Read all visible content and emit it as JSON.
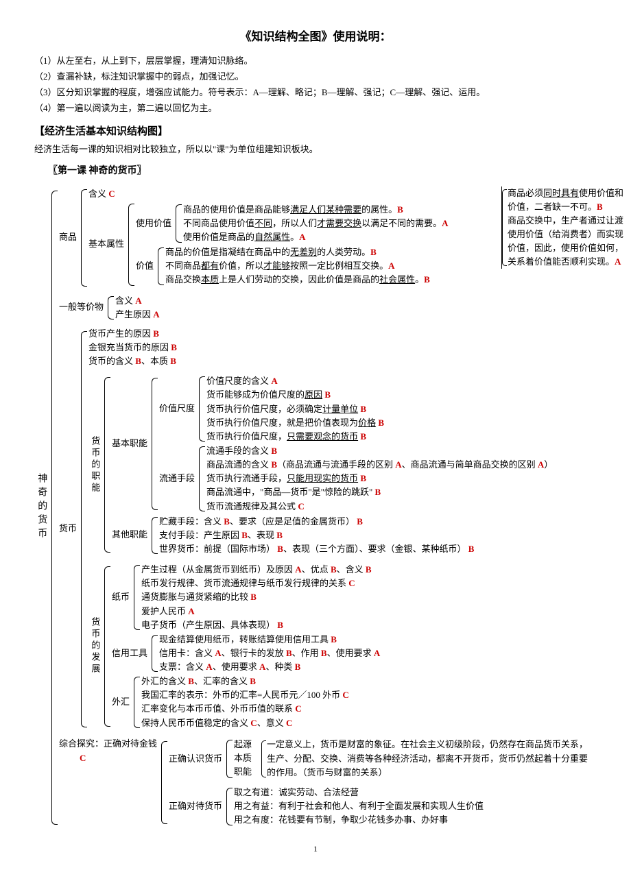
{
  "title": "《知识结构全图》使用说明：",
  "intro": [
    "（1）从左至右，从上到下，层层掌握，理清知识脉络。",
    "（2）查漏补缺，标注知识掌握中的弱点，加强记忆。",
    "（3）区分知识掌握的程度，增强应试能力。符号表示：A—理解、略记；B—理解、强记；C—理解、强记、运用。",
    "（4）第一遍以阅读为主，第二遍以回忆为主。"
  ],
  "section_title": "【经济生活基本知识结构图】",
  "subtitle": "经济生活每一课的知识相对比较独立，所以以\"课\"为单位组建知识板块。",
  "lesson_title": "〖第一课 神奇的货币〗",
  "root": "神奇的货币",
  "nodes": {
    "shangpin": "商品",
    "hanyi": "含义",
    "jibenshuxing": "基本属性",
    "shiyongjiazhi": "使用价值",
    "jiazhi": "价值",
    "svj1": "商品的使用价值是商品能够",
    "svj1u": "满足人们某种需要",
    "svj1e": "的属性。",
    "svj2a": "不同商品使用价值",
    "svj2u1": "不同",
    "svj2b": "，所以人们",
    "svj2u2": "才需要交换",
    "svj2c": "以满足不同的需要。",
    "svj3a": "使用价值是商品的",
    "svj3u": "自然属性",
    "svj3e": "。",
    "jz1a": "商品的价值是指凝结在商品中的",
    "jz1u": "无差别",
    "jz1b": "的人类劳动。",
    "jz2a": "不同商品",
    "jz2u1": "都有",
    "jz2b": "价值，所以",
    "jz2u2": "才能够",
    "jz2c": "按照一定比例相互交换。",
    "jz3a": "商品交换",
    "jz3u1": "本质",
    "jz3b": "上是人们劳动的交换，因此价值是商品的",
    "jz3u2": "社会属性",
    "jz3e": "。",
    "side1a": "商品必须",
    "side1u": "同时具有",
    "side1b": "使用价值和价值，二者缺一不可。",
    "side2": "商品交换中，生产者通过让渡使用价值（给消费者）而实现价值，因此，使用价值如何，关系着价值能否顺利实现。",
    "yiban": "一般等价物",
    "yb_hanyi": "含义",
    "yb_yuanyin": "产生原因",
    "huobi": "货币",
    "hb1": "货币产生的原因",
    "hb2": "金银充当货币的原因",
    "hb3a": "货币的含义",
    "hb3b": "、本质",
    "zhineng": "货币的职能",
    "jiben": "基本职能",
    "jzcd": "价值尺度",
    "jzcd1": "价值尺度的含义",
    "jzcd2a": "货币能够成为价值尺度的",
    "jzcd2u": "原因",
    "jzcd3a": "货币执行价值尺度，必须确定",
    "jzcd3u": "计量单位",
    "jzcd4a": "货币执行价值尺度，就是把价值表现为",
    "jzcd4u": "价格",
    "jzcd5a": "货币执行价值尺度，",
    "jzcd5u": "只需要观念的货币",
    "ltsd": "流通手段",
    "lt1": "流通手段的含义",
    "lt2a": "商品流通的含义",
    "lt2b": "（商品流通与流通手段的区别",
    "lt2c": "、商品流通与简单商品交换的区别",
    "lt2d": "）",
    "lt3a": "货币执行流通手段，",
    "lt3u": "只能用现实的货币",
    "lt4": "商品流通中，\"商品—货币\"是\"惊险的跳跃\"",
    "lt5": "货币流通规律及其公式",
    "qita": "其他职能",
    "qt1a": "贮藏手段：含义",
    "qt1b": "、要求（应是足值的金属货币）",
    "qt2a": "支付手段：产生原因",
    "qt2b": "、表现",
    "qt3a": "世界货币：前提（国际市场）",
    "qt3b": "、表现（三个方面）、要求（金银、某种纸币）",
    "fazhan": "货币的发展",
    "zhibi": "纸币",
    "zb1a": "产生过程（从金属货币到纸币）及原因",
    "zb1b": "、优点",
    "zb1c": "、含义",
    "zb2": "纸币发行规律、货币流通规律与纸币发行规律的关系",
    "zb3": "通货膨胀与通货紧缩的比较",
    "zb4": "爱护人民币",
    "zb5": "电子货币（产生原因、具体表现）",
    "xinyong": "信用工具",
    "xy1": "现金结算使用纸币，转账结算使用信用工具",
    "xy2a": "信用卡：含义",
    "xy2b": "、银行卡的发放",
    "xy2c": "、作用",
    "xy2d": "、使用要求",
    "xy3a": "支票：含义",
    "xy3b": "、使用要求",
    "xy3c": "、种类",
    "waihui": "外汇",
    "wh1a": "外汇的含义",
    "wh1b": "、汇率的含义",
    "wh2": "我国汇率的表示：外币的汇率=人民币元／100 外币",
    "wh3": "汇率变化与本币币值、外币币值的联系",
    "wh4a": "保持人民币币值稳定的含义",
    "wh4b": "、意义",
    "zonghe": "综合探究：正确对待金钱",
    "renshi": "正确认识货币",
    "rs1": "起源",
    "rs2": "本质",
    "rs3": "职能",
    "rs_side": "一定意义上，货币是财富的象征。在社会主义初级阶段，仍然存在商品货币关系，生产、分配、交换、消费等各种经济活动，都离不开货币，货币仍然起着十分重要的作用。（货币与财富的关系）",
    "duidai": "正确对待货币",
    "dd1": "取之有道：诚实劳动、合法经营",
    "dd2": "用之有益：有利于社会和他人、有利于全面发展和实现人生价值",
    "dd3": "用之有度：花钱要有节制，争取少花钱多办事、办好事"
  },
  "page": "1"
}
